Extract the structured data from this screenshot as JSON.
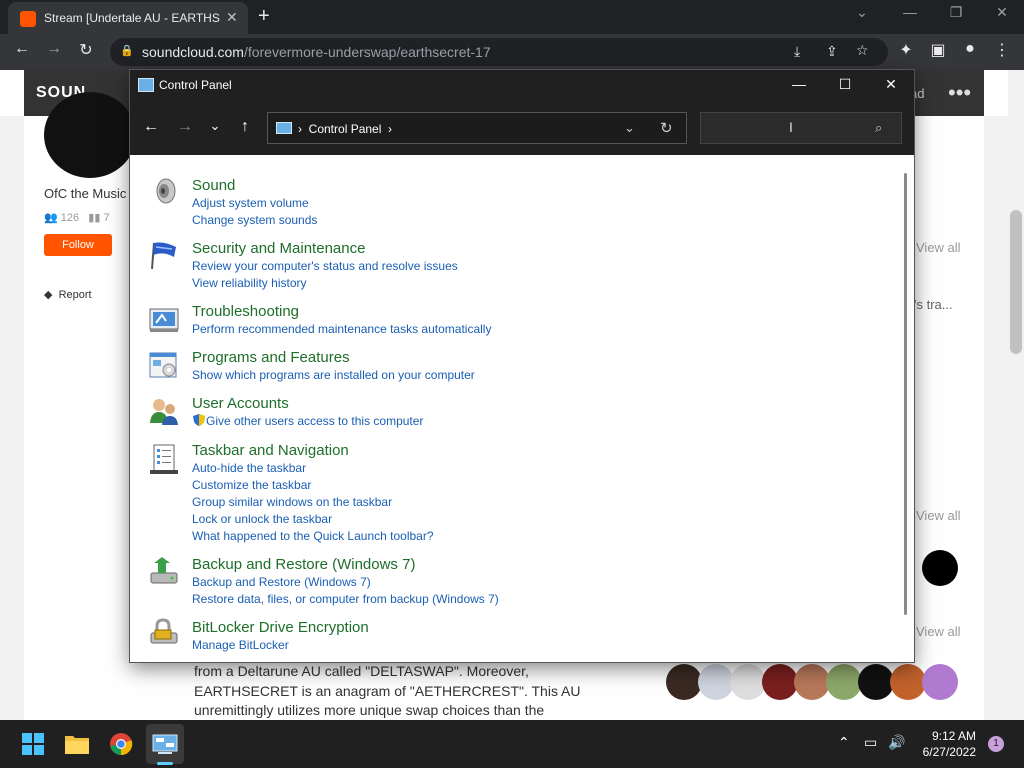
{
  "browser": {
    "tab_title": "Stream [Undertale AU - EARTHSE",
    "tab_close": "✕",
    "new_tab": "+",
    "url_host": "soundcloud.com",
    "url_path": "/forevermore-underswap/earthsecret-17"
  },
  "soundcloud": {
    "logo_text": "SOUN",
    "header_partial": "ad",
    "artist_partial": "OfC the Music",
    "followers": "126",
    "tracks": "7",
    "follow_label": "Follow",
    "report_label": "Report",
    "view_all": "View all",
    "sidebar_partial": "'s tra...",
    "description_lines": [
      "from a Deltarune AU called \"DELTASWAP\". Moreover,",
      "EARTHSECRET is an anagram of \"AETHERCREST\". This AU",
      "unremittingly utilizes more unique swap choices than the"
    ]
  },
  "control_panel": {
    "window_title": "Control Panel",
    "breadcrumb": "Control Panel",
    "categories": [
      {
        "title": "Sound",
        "links": [
          "Adjust system volume",
          "Change system sounds"
        ],
        "icon": "speaker-icon"
      },
      {
        "title": "Security and Maintenance",
        "links": [
          "Review your computer's status and resolve issues",
          "View reliability history"
        ],
        "icon": "flag-icon"
      },
      {
        "title": "Troubleshooting",
        "links": [
          "Perform recommended maintenance tasks automatically"
        ],
        "icon": "troubleshoot-icon"
      },
      {
        "title": "Programs and Features",
        "links": [
          "Show which programs are installed on your computer"
        ],
        "icon": "programs-icon"
      },
      {
        "title": "User Accounts",
        "links": [
          "Give other users access to this computer"
        ],
        "icon": "users-icon"
      },
      {
        "title": "Taskbar and Navigation",
        "links": [
          "Auto-hide the taskbar",
          "Customize the taskbar",
          "Group similar windows on the taskbar",
          "Lock or unlock the taskbar",
          "What happened to the Quick Launch toolbar?"
        ],
        "icon": "taskbar-icon"
      },
      {
        "title": "Backup and Restore (Windows 7)",
        "links": [
          "Backup and Restore (Windows 7)",
          "Restore data, files, or computer from backup (Windows 7)"
        ],
        "icon": "backup-icon"
      },
      {
        "title": "BitLocker Drive Encryption",
        "links": [
          "Manage BitLocker"
        ],
        "icon": "bitlocker-icon"
      }
    ]
  },
  "taskbar": {
    "time": "9:12 AM",
    "date": "6/27/2022",
    "notifications": "1"
  },
  "colors": {
    "category_title": "#1e6e2a",
    "link": "#1a5fb4",
    "soundcloud_orange": "#ff5500"
  }
}
